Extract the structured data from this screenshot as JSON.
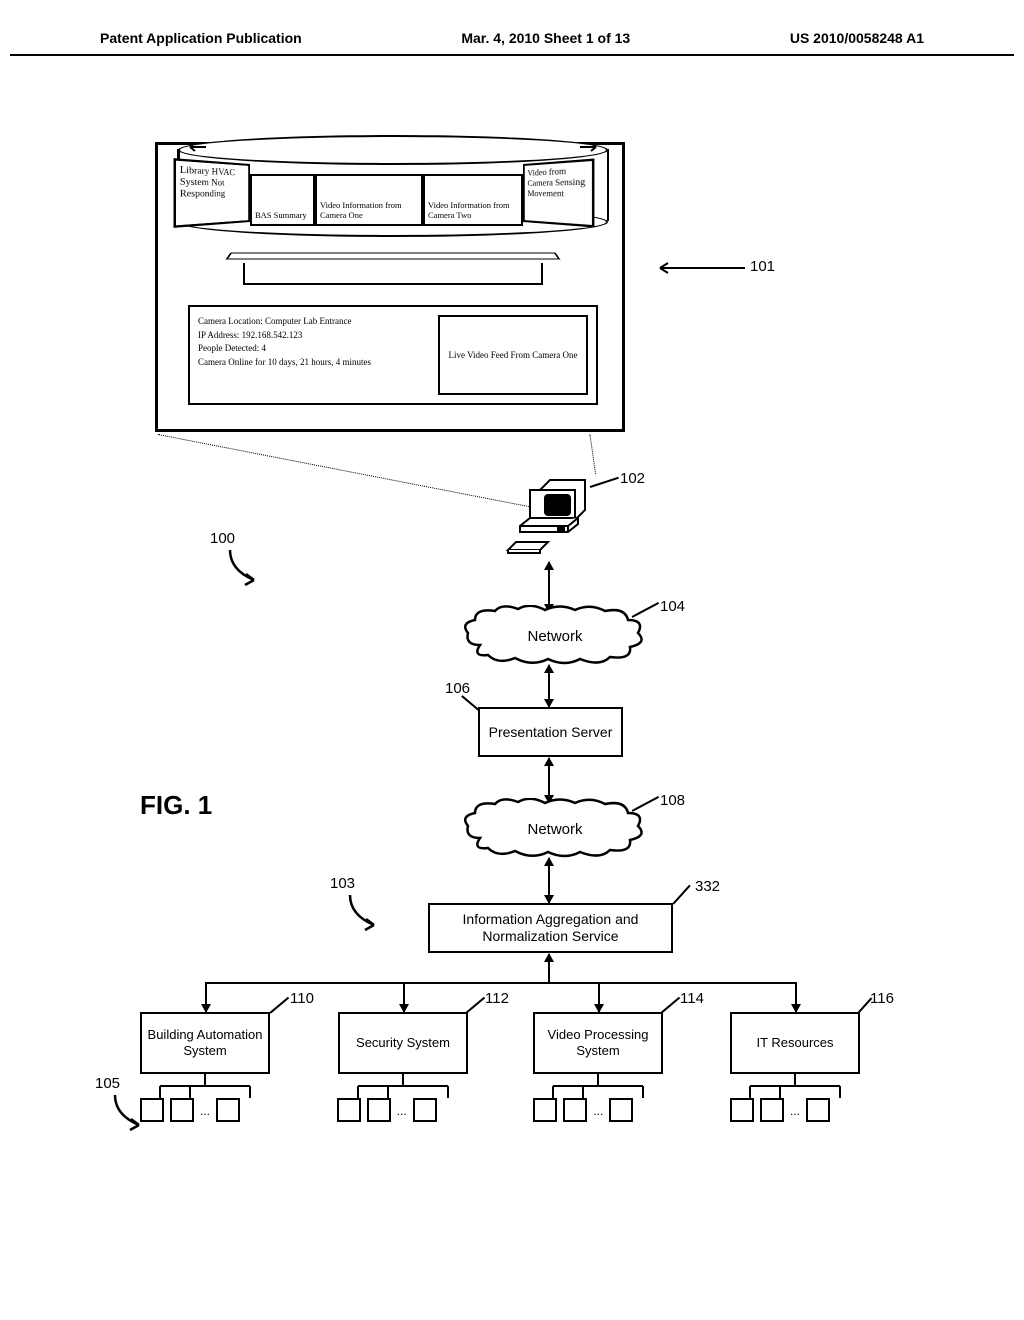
{
  "header": {
    "left": "Patent Application Publication",
    "center": "Mar. 4, 2010  Sheet 1 of 13",
    "right": "US 2010/0058248 A1"
  },
  "figure_label": "FIG. 1",
  "carousel": {
    "item1": "Library HVAC System Not Responding",
    "item2": "BAS Summary",
    "item3": "Video Information from Camera One",
    "item4": "Video Information from Camera Two",
    "item5": "Video from Camera Sensing Movement"
  },
  "detail": {
    "line1": "Camera Location:   Computer Lab Entrance",
    "line2": "IP Address:   192.168.542.123",
    "line3": "People Detected:   4",
    "line4": "Camera Online for 10 days, 21 hours, 4 minutes",
    "video": "Live Video Feed From Camera One"
  },
  "nodes": {
    "network1": "Network",
    "presentation": "Presentation Server",
    "network2": "Network",
    "aggregation": "Information Aggregation and Normalization Service",
    "bas": "Building Automation System",
    "security": "Security System",
    "video": "Video Processing System",
    "it": "IT Resources"
  },
  "refs": {
    "r100": "100",
    "r101": "101",
    "r102": "102",
    "r103": "103",
    "r104": "104",
    "r105": "105",
    "r106": "106",
    "r108": "108",
    "r110": "110",
    "r112": "112",
    "r114": "114",
    "r116": "116",
    "r332": "332"
  },
  "ellipsis": "..."
}
